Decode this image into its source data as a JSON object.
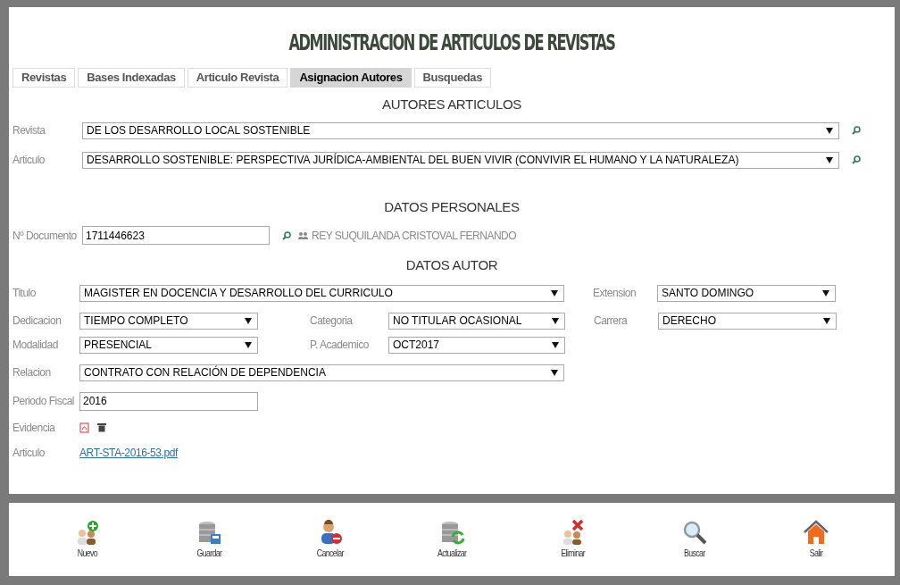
{
  "title": "ADMINISTRACION DE ARTICULOS DE REVISTAS",
  "tabs": [
    {
      "label": "Revistas",
      "selected": false
    },
    {
      "label": "Bases Indexadas",
      "selected": false
    },
    {
      "label": "Articulo Revista",
      "selected": false
    },
    {
      "label": "Asignacion Autores",
      "selected": true
    },
    {
      "label": "Busquedas",
      "selected": false
    }
  ],
  "autores_articulos": {
    "heading": "AUTORES ARTICULOS",
    "fields": [
      {
        "label": "Revista",
        "value": "DE LOS DESARROLLO LOCAL SOSTENIBLE"
      },
      {
        "label": "Articulo",
        "value": "DESARROLLO SOSTENIBLE: PERSPECTIVA JURÍDICA-AMBIENTAL DEL BUEN VIVIR (CONVIVIR EL HUMANO Y LA NATURALEZA)"
      }
    ]
  },
  "datos_personales": {
    "heading": "DATOS PERSONALES",
    "document_label": "Nº Documento",
    "document_value": "1711446623",
    "person_name": "REY SUQUILANDA CRISTOVAL FERNANDO"
  },
  "datos_autor": {
    "heading": "DATOS AUTOR",
    "titulo": {
      "label": "Titulo",
      "value": "MAGISTER EN DOCENCIA Y DESARROLLO DEL CURRICULO"
    },
    "extension": {
      "label": "Extension",
      "value": "SANTO DOMINGO"
    },
    "dedicacion": {
      "label": "Dedicacion",
      "value": "TIEMPO COMPLETO"
    },
    "categoria": {
      "label": "Categoria",
      "value": "NO TITULAR OCASIONAL"
    },
    "carrera": {
      "label": "Carrera",
      "value": "DERECHO"
    },
    "modalidad": {
      "label": "Modalidad",
      "value": "PRESENCIAL"
    },
    "p_academico": {
      "label": "P. Academico",
      "value": "OCT2017"
    },
    "relacion": {
      "label": "Relacion",
      "value": "CONTRATO CON RELACIÓN DE DEPENDENCIA"
    },
    "periodo_fiscal": {
      "label": "Periodo Fiscal",
      "value": "2016"
    },
    "evidencia": {
      "label": "Evidencia"
    },
    "articulo": {
      "label": "Articulo",
      "link": "ART-STA-2016-53.pdf"
    }
  },
  "toolbar": [
    {
      "label": "Nuevo"
    },
    {
      "label": "Guardar"
    },
    {
      "label": "Cancelar"
    },
    {
      "label": "Actualizar"
    },
    {
      "label": "Eliminar"
    },
    {
      "label": "Buscar"
    },
    {
      "label": "Salir"
    }
  ]
}
